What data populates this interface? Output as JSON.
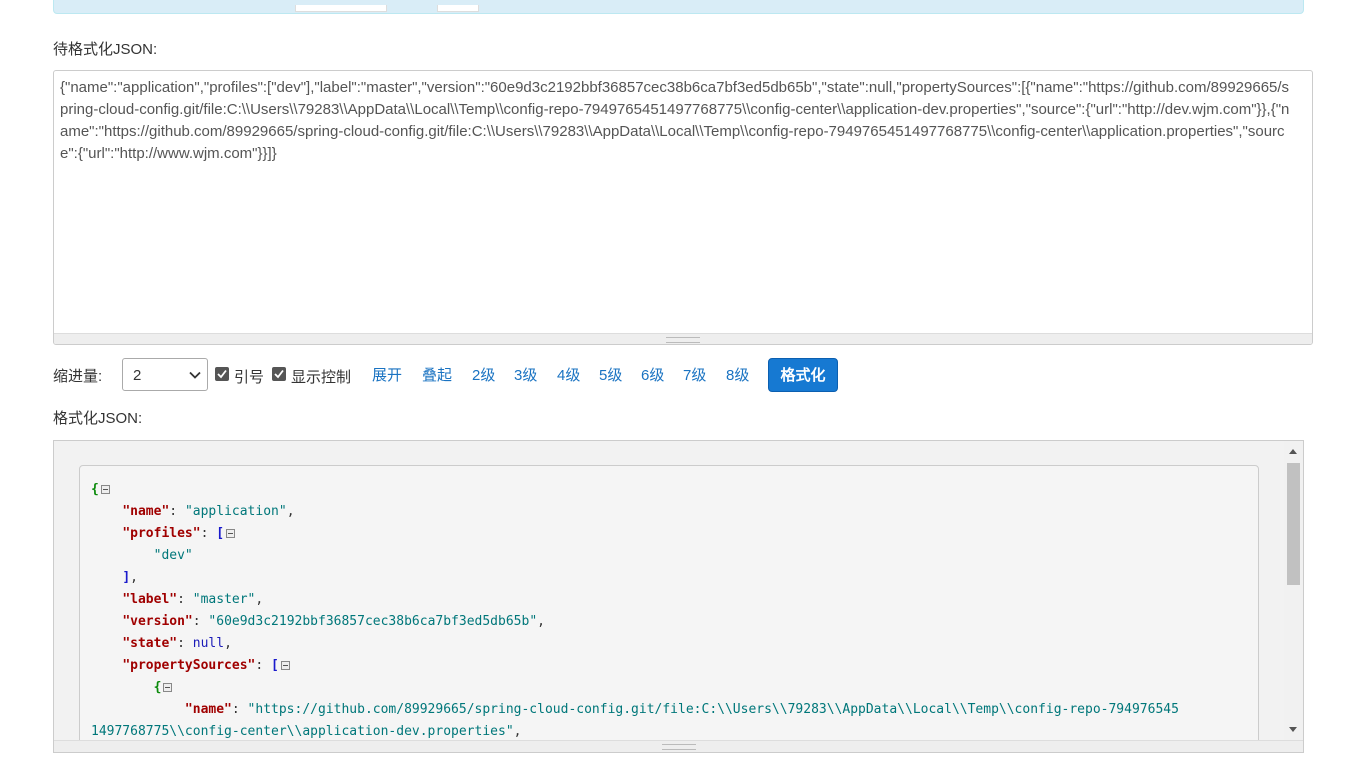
{
  "input_label": "待格式化JSON:",
  "raw_json": "{\"name\":\"application\",\"profiles\":[\"dev\"],\"label\":\"master\",\"version\":\"60e9d3c2192bbf36857cec38b6ca7bf3ed5db65b\",\"state\":null,\"propertySources\":[{\"name\":\"https://github.com/89929665/spring-cloud-config.git/file:C:\\\\Users\\\\79283\\\\AppData\\\\Local\\\\Temp\\\\config-repo-7949765451497768775\\\\config-center\\\\application-dev.properties\",\"source\":{\"url\":\"http://dev.wjm.com\"}},{\"name\":\"https://github.com/89929665/spring-cloud-config.git/file:C:\\\\Users\\\\79283\\\\AppData\\\\Local\\\\Temp\\\\config-repo-7949765451497768775\\\\config-center\\\\application.properties\",\"source\":{\"url\":\"http://www.wjm.com\"}}]}",
  "toolbar": {
    "indent_label": "缩进量:",
    "indent_value": "2",
    "quotes_label": "引号",
    "show_control_label": "显示控制",
    "expand_label": "展开",
    "collapse_label": "叠起",
    "levels": [
      "2级",
      "3级",
      "4级",
      "5级",
      "6级",
      "7级",
      "8级"
    ],
    "format_button": "格式化"
  },
  "output_label": "格式化JSON:",
  "formatted": {
    "open_brace": "{",
    "k_name": "\"name\"",
    "v_name": "\"application\"",
    "k_profiles": "\"profiles\"",
    "v_profile_0": "\"dev\"",
    "k_label": "\"label\"",
    "v_label": "\"master\"",
    "k_version": "\"version\"",
    "v_version": "\"60e9d3c2192bbf36857cec38b6ca7bf3ed5db65b\"",
    "k_state": "\"state\"",
    "v_state": "null",
    "k_property_sources": "\"propertySources\"",
    "k_ps_name": "\"name\"",
    "v_ps_name_line1": "\"https://github.com/89929665/spring-cloud-config.git/file:C:\\\\Users\\\\79283\\\\AppData\\\\Local\\\\Temp\\\\config-repo-794976545",
    "v_ps_name_line2": "1497768775\\\\config-center\\\\application-dev.properties\""
  },
  "colors": {
    "key": "#a00000",
    "string": "#00777a",
    "null": "#1b1bb8",
    "button": "#1679d2",
    "link": "#1a73c2"
  }
}
